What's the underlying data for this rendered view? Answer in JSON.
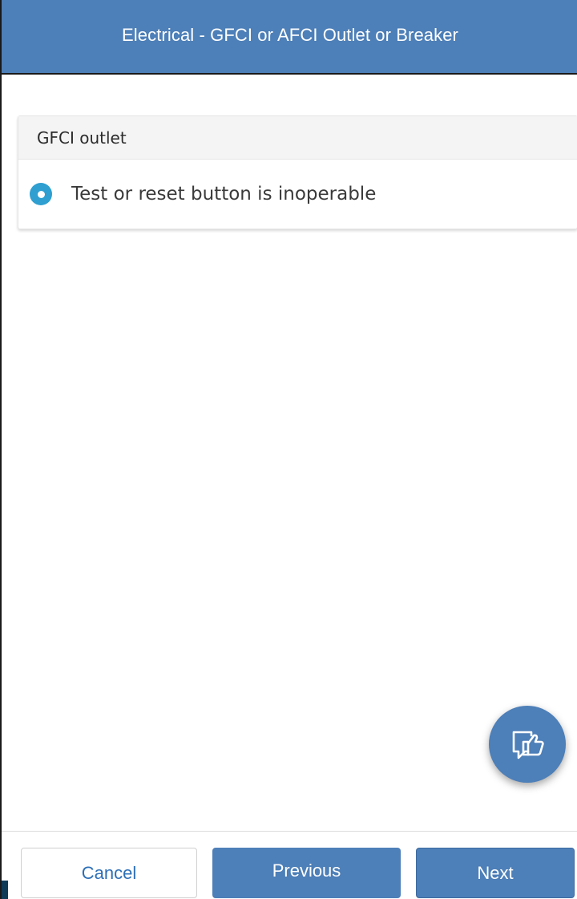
{
  "header": {
    "title": "Electrical - GFCI or AFCI Outlet or Breaker"
  },
  "section": {
    "title": "GFCI outlet",
    "options": [
      {
        "label": "Test or reset button is inoperable",
        "selected": true
      }
    ]
  },
  "fab": {
    "icon": "thumbs-up-feedback-icon"
  },
  "footer": {
    "cancel_label": "Cancel",
    "previous_label": "Previous",
    "next_label": "Next"
  },
  "colors": {
    "header_bg": "#4d7fb8",
    "radio_selected": "#2e9fd0",
    "cancel_text": "#2d6fb7"
  }
}
